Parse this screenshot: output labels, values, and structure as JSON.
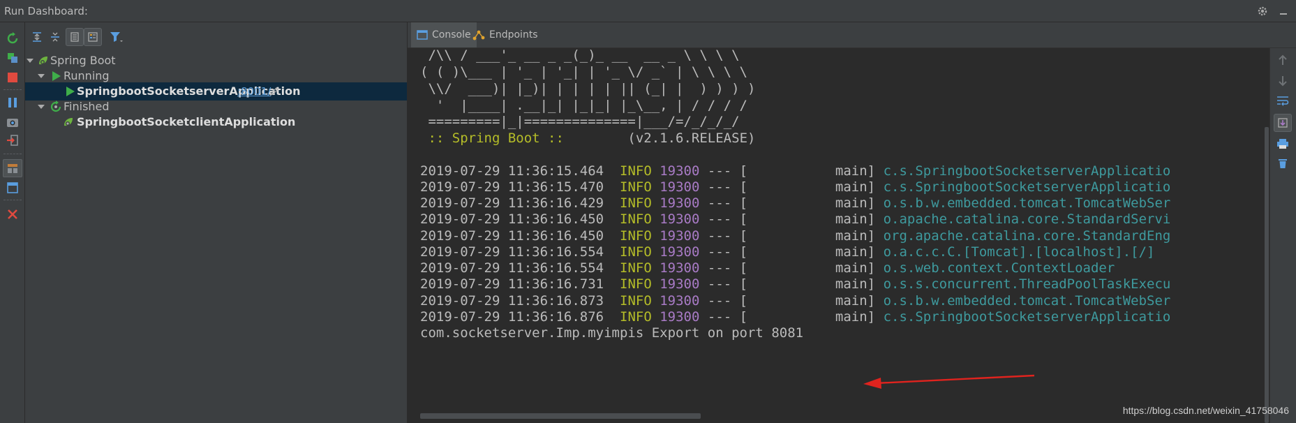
{
  "window": {
    "title": "Run Dashboard:"
  },
  "tree": {
    "root": {
      "label": "Spring Boot"
    },
    "running": {
      "label": "Running"
    },
    "server_app": {
      "label": "SpringbootSocketserverApplication",
      "port": ":8001/"
    },
    "finished": {
      "label": "Finished"
    },
    "client_app": {
      "label": "SpringbootSocketclientApplication"
    }
  },
  "tabs": [
    {
      "label": "Console"
    },
    {
      "label": "Endpoints"
    }
  ],
  "console": {
    "banner": [
      " /\\\\ / ___'_ __ _ _(_)_ __  __ _ \\ \\ \\ \\",
      "( ( )\\___ | '_ | '_| | '_ \\/ _` | \\ \\ \\ \\",
      " \\\\/  ___)| |_)| | | | | || (_| |  ) ) ) )",
      "  '  |____| .__|_| |_|_| |_\\__, | / / / /",
      " =========|_|==============|___/=/_/_/_/"
    ],
    "boot_label": " :: Spring Boot ::",
    "boot_version": "        (v2.1.6.RELEASE)",
    "logs": [
      {
        "ts": "2019-07-29 11:36:15.464",
        "level": "INFO",
        "pid": "19300",
        "sep": "--- [",
        "thread": "           main]",
        "logger": "c.s.SpringbootSocketserverApplicatio"
      },
      {
        "ts": "2019-07-29 11:36:15.470",
        "level": "INFO",
        "pid": "19300",
        "sep": "--- [",
        "thread": "           main]",
        "logger": "c.s.SpringbootSocketserverApplicatio"
      },
      {
        "ts": "2019-07-29 11:36:16.429",
        "level": "INFO",
        "pid": "19300",
        "sep": "--- [",
        "thread": "           main]",
        "logger": "o.s.b.w.embedded.tomcat.TomcatWebSer"
      },
      {
        "ts": "2019-07-29 11:36:16.450",
        "level": "INFO",
        "pid": "19300",
        "sep": "--- [",
        "thread": "           main]",
        "logger": "o.apache.catalina.core.StandardServi"
      },
      {
        "ts": "2019-07-29 11:36:16.450",
        "level": "INFO",
        "pid": "19300",
        "sep": "--- [",
        "thread": "           main]",
        "logger": "org.apache.catalina.core.StandardEng"
      },
      {
        "ts": "2019-07-29 11:36:16.554",
        "level": "INFO",
        "pid": "19300",
        "sep": "--- [",
        "thread": "           main]",
        "logger": "o.a.c.c.C.[Tomcat].[localhost].[/]"
      },
      {
        "ts": "2019-07-29 11:36:16.554",
        "level": "INFO",
        "pid": "19300",
        "sep": "--- [",
        "thread": "           main]",
        "logger": "o.s.web.context.ContextLoader"
      },
      {
        "ts": "2019-07-29 11:36:16.731",
        "level": "INFO",
        "pid": "19300",
        "sep": "--- [",
        "thread": "           main]",
        "logger": "o.s.s.concurrent.ThreadPoolTaskExecu"
      },
      {
        "ts": "2019-07-29 11:36:16.873",
        "level": "INFO",
        "pid": "19300",
        "sep": "--- [",
        "thread": "           main]",
        "logger": "o.s.b.w.embedded.tomcat.TomcatWebSer"
      },
      {
        "ts": "2019-07-29 11:36:16.876",
        "level": "INFO",
        "pid": "19300",
        "sep": "--- [",
        "thread": "           main]",
        "logger": "c.s.SpringbootSocketserverApplicatio"
      }
    ],
    "export_line": "com.socketserver.Imp.myimpis Export on port 8081"
  },
  "watermark": "https://blog.csdn.net/weixin_41758046",
  "colors": {
    "background": "#2b2b2b",
    "panel": "#3c3f41",
    "selection": "#0d293e",
    "log_level": "#b5bd28",
    "pid": "#a97bc6",
    "logger": "#3e9a9e",
    "link": "#5b9bd5",
    "run_green": "#3fae4a",
    "stop_red": "#e04a3f",
    "annotation_arrow": "#e0231e"
  },
  "icons": [
    "gear-icon",
    "minimize-icon",
    "rerun-icon",
    "stop-icon",
    "pause-icon",
    "camera-icon",
    "exit-icon",
    "layout-icon",
    "close-icon",
    "expand-all-icon",
    "collapse-all-icon",
    "group-icon",
    "filter-icon",
    "spring-boot-icon",
    "run-icon",
    "pencil-icon",
    "console-icon",
    "endpoints-icon",
    "up-arrow-icon",
    "down-arrow-icon",
    "wrap-icon",
    "scroll-to-end-icon",
    "print-icon",
    "trash-icon"
  ]
}
